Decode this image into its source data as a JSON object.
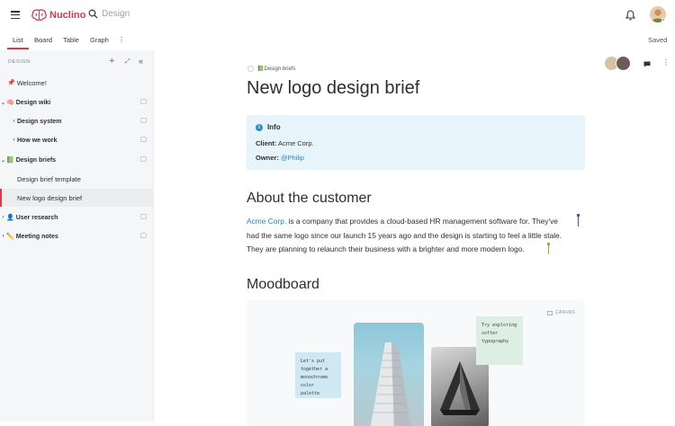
{
  "app": {
    "name": "Nuclino",
    "brand_color": "#d63c4b",
    "accent_link": "#2a84c4"
  },
  "topbar": {
    "search_text": "Design"
  },
  "view_tabs": [
    {
      "label": "List",
      "active": true
    },
    {
      "label": "Board",
      "active": false
    },
    {
      "label": "Table",
      "active": false
    },
    {
      "label": "Graph",
      "active": false
    }
  ],
  "status": {
    "saved": "Saved"
  },
  "sidebar": {
    "header": "DESIGN",
    "items": [
      {
        "label": "Welcome!",
        "icon": "pin-icon",
        "indent": 0
      },
      {
        "label": "Design wiki",
        "icon": "brain-emoji",
        "chevron": "down",
        "indent": 0
      },
      {
        "label": "Design system",
        "chevron": "right",
        "indent": 1
      },
      {
        "label": "How we work",
        "chevron": "right",
        "indent": 1
      },
      {
        "label": "Design briefs",
        "icon": "green-book-emoji",
        "chevron": "down",
        "indent": 0
      },
      {
        "label": "Design brief template",
        "indent": 2
      },
      {
        "label": "New logo design brief",
        "indent": 2,
        "selected": true
      },
      {
        "label": "User research",
        "icon": "user-emoji",
        "chevron": "right",
        "indent": 0
      },
      {
        "label": "Meeting notes",
        "icon": "pencil-emoji",
        "chevron": "right",
        "indent": 0
      }
    ]
  },
  "document": {
    "breadcrumb": "Design briefs",
    "title": "New logo design brief",
    "info": {
      "heading": "Info",
      "client_label": "Client:",
      "client_value": "Acme Corp.",
      "owner_label": "Owner:",
      "owner_value": "@Philip"
    },
    "section1_heading": "About the customer",
    "para_link": "Acme Corp.",
    "para_line1": " is a company that provides a cloud-based HR management software for. They've",
    "para_line2": "had the same logo since our launch 15 years ago and the design is starting to feel a little stale.",
    "para_line3": "They are planning to relaunch their business with a brighter and more modern logo.",
    "section2_heading": "Moodboard",
    "canvas": {
      "label": "CANVAS",
      "sticky_blue": "Let's put\ntogether a\nmonochrome\ncolor palette",
      "sticky_green": "Try exploring\nsofter\ntypography"
    }
  }
}
